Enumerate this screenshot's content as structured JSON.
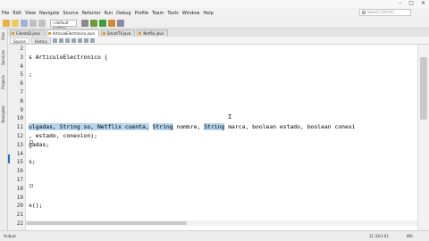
{
  "window": {
    "minimize": "–",
    "maximize": "□",
    "close": "✕"
  },
  "menu": [
    "File",
    "Edit",
    "View",
    "Navigate",
    "Source",
    "Refactor",
    "Run",
    "Debug",
    "Profile",
    "Team",
    "Tools",
    "Window",
    "Help"
  ],
  "search": {
    "placeholder": "Search (Ctrl+I)"
  },
  "toolbar": {
    "config": "<default config>"
  },
  "side_tabs": [
    "Files",
    "Services",
    "Projects",
    "Navigator"
  ],
  "file_tabs": [
    "ClienteD.java",
    "ArticuloElectronico.java",
    "SmartTV.java",
    "Netflix.java"
  ],
  "sub_tabs": {
    "source": "Source",
    "history": "History"
  },
  "lines": [
    {
      "n": "2",
      "text": ""
    },
    {
      "n": "3",
      "text": "s ArticuloElectronico {"
    },
    {
      "n": "4",
      "text": ""
    },
    {
      "n": "5",
      "text": ";"
    },
    {
      "n": "6",
      "text": ""
    },
    {
      "n": "7",
      "text": ""
    },
    {
      "n": "8",
      "text": ""
    },
    {
      "n": "9",
      "text": ""
    },
    {
      "n": "10",
      "text": ""
    },
    {
      "n": "11",
      "sel1": "ulgadas, String so, Netflix cuenta,",
      "mid1": " ",
      "sel2": "String",
      "mid2": " nombre, ",
      "sel3": "String",
      "rest": " marca, boolean estado, boolean conexi"
    },
    {
      "n": "12",
      "text": ", estado, conexion);"
    },
    {
      "n": "13",
      "text": "gadas;"
    },
    {
      "n": "14",
      "text": ""
    },
    {
      "n": "15",
      "text": "s;"
    },
    {
      "n": "16",
      "text": ""
    },
    {
      "n": "17",
      "text": ""
    },
    {
      "n": "18",
      "text": ""
    },
    {
      "n": "19",
      "text": ""
    },
    {
      "n": "20",
      "text": "x();"
    },
    {
      "n": "21",
      "text": ""
    },
    {
      "n": "22",
      "text": ""
    }
  ],
  "status": {
    "left": "Output",
    "position": "11:33/1:01",
    "mode": "INS"
  }
}
